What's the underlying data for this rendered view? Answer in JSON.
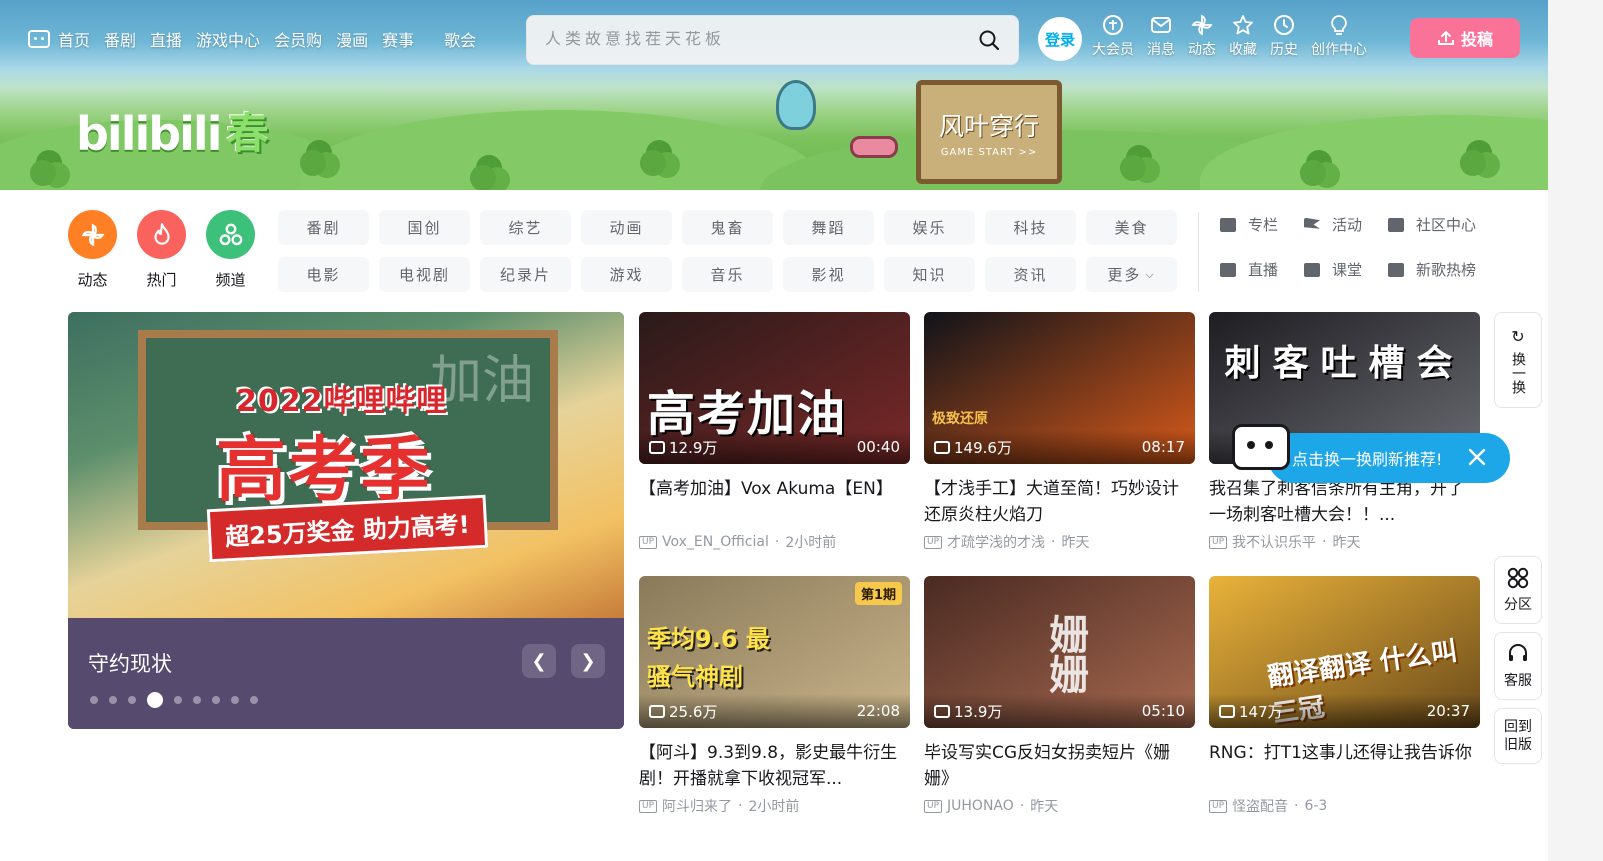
{
  "nav": {
    "items": [
      "首页",
      "番剧",
      "直播",
      "游戏中心",
      "会员购",
      "漫画",
      "赛事",
      "歌会"
    ],
    "search_placeholder": "人类故意找茬天花板",
    "login": "登录",
    "entries": [
      "大会员",
      "消息",
      "动态",
      "收藏",
      "历史",
      "创作中心"
    ],
    "upload": "投稿"
  },
  "banner": {
    "logo_text": "bilibili",
    "season": "春",
    "sign_title": "风叶穿行",
    "sign_sub": "GAME START >>"
  },
  "quick": [
    {
      "label": "动态",
      "icon": "dynamic-icon",
      "color": "#ff7f24"
    },
    {
      "label": "热门",
      "icon": "fire-icon",
      "color": "#f9625d"
    },
    {
      "label": "频道",
      "icon": "channel-icon",
      "color": "#3dc17a"
    }
  ],
  "channels": [
    "番剧",
    "国创",
    "综艺",
    "动画",
    "鬼畜",
    "舞蹈",
    "娱乐",
    "科技",
    "美食",
    "电影",
    "电视剧",
    "纪录片",
    "游戏",
    "音乐",
    "影视",
    "知识",
    "资讯",
    "更多"
  ],
  "extra": [
    {
      "label": "专栏",
      "icon": "column-icon"
    },
    {
      "label": "活动",
      "icon": "activity-icon"
    },
    {
      "label": "社区中心",
      "icon": "community-icon"
    },
    {
      "label": "直播",
      "icon": "live-icon"
    },
    {
      "label": "课堂",
      "icon": "classroom-icon"
    },
    {
      "label": "新歌热榜",
      "icon": "music-icon"
    }
  ],
  "carousel": {
    "image_year": "2022哔哩哔哩",
    "image_title": "高考季",
    "image_banner": "超25万奖金 助力高考!",
    "image_chalk": "加油",
    "caption": "守约现状",
    "dot_count": 9,
    "active_dot": 3
  },
  "videos": [
    {
      "title": "【高考加油】Vox Akuma【EN】",
      "author": "Vox_EN_Official",
      "time": "2小时前",
      "views": "12.9万",
      "duration": "00:40",
      "thumb_text": "高考加油",
      "colors": [
        "#2a1a1a",
        "#7a2828"
      ]
    },
    {
      "title": "【才浅手工】大道至简！巧妙设计还原炎柱火焰刀",
      "author": "才疏学浅的才浅",
      "time": "昨天",
      "views": "149.6万",
      "duration": "08:17",
      "thumb_text": "极致还原",
      "colors": [
        "#10131a",
        "#d85a1a"
      ]
    },
    {
      "title": "我召集了刺客信条所有主角，开了一场刺客吐槽大会！！...",
      "author": "我不认识乐平",
      "time": "昨天",
      "views": "",
      "duration": "",
      "thumb_text": "刺客吐槽会",
      "colors": [
        "#1d1d22",
        "#6a6a72"
      ]
    },
    {
      "title": "【阿斗】9.3到9.8，影史最牛衍生剧！开播就拿下收视冠军...",
      "author": "阿斗归来了",
      "time": "2小时前",
      "views": "25.6万",
      "duration": "22:08",
      "thumb_text": "季均9.6 最骚气神剧",
      "badge": "第1期",
      "colors": [
        "#8a7a5a",
        "#c9b48a"
      ]
    },
    {
      "title": "毕设写实CG反妇女拐卖短片《姗姗》",
      "author": "JUHONAO",
      "time": "昨天",
      "views": "13.9万",
      "duration": "05:10",
      "thumb_text": "姗姗",
      "colors": [
        "#4a2a22",
        "#a86a50"
      ]
    },
    {
      "title": "RNG：打T1这事儿还得让我告诉你",
      "author": "怪盗配音",
      "time": "6-3",
      "views": "147万",
      "duration": "20:37",
      "thumb_text": "翻译翻译 什么叫三冠",
      "colors": [
        "#e9b23a",
        "#6a4a1a"
      ]
    }
  ],
  "side": {
    "refresh": "换一换",
    "category": "分区",
    "service": "客服",
    "old": "回到旧版"
  },
  "tip": "点击换一换刷新推荐!"
}
